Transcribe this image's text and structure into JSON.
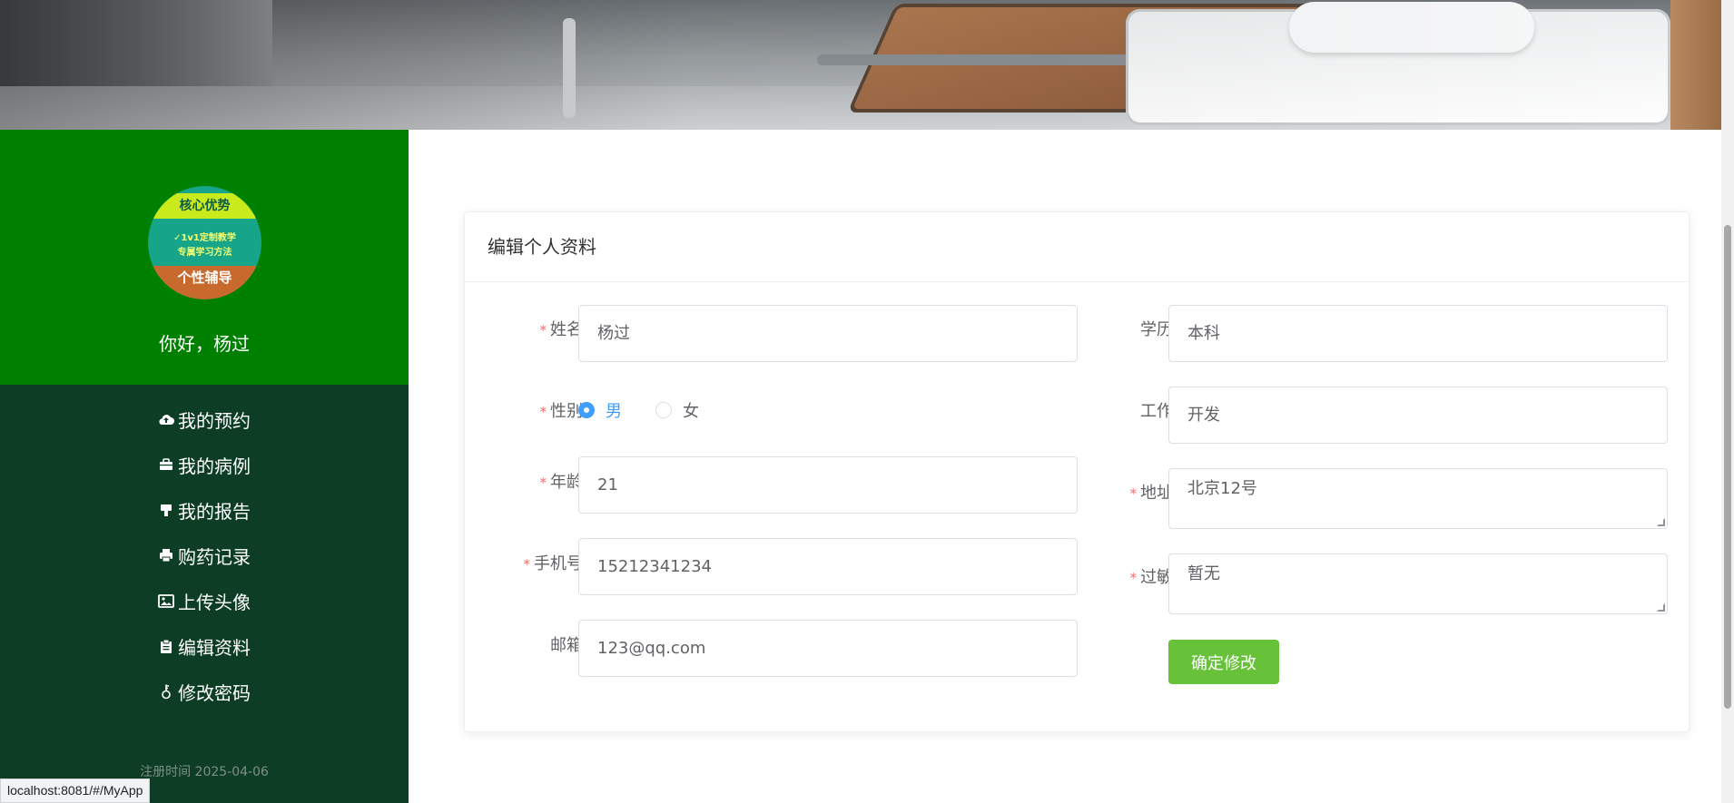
{
  "sidebar": {
    "avatar": {
      "badge_title": "核心优势",
      "line1": "✓1v1定制教学",
      "line2": "专属学习方法",
      "badge_bottom": "个性辅导"
    },
    "greeting": "你好，杨过",
    "menu": [
      {
        "label": "我的预约",
        "icon": "cloud-upload-icon"
      },
      {
        "label": "我的病例",
        "icon": "briefcase-icon"
      },
      {
        "label": "我的报告",
        "icon": "desk-icon"
      },
      {
        "label": "购药记录",
        "icon": "printer-icon"
      },
      {
        "label": "上传头像",
        "icon": "picture-icon"
      },
      {
        "label": "编辑资料",
        "icon": "clipboard-icon"
      },
      {
        "label": "修改密码",
        "icon": "key-icon"
      }
    ],
    "register_time": "注册时间 2025-04-06"
  },
  "profile_form": {
    "title": "编辑个人资料",
    "name": {
      "label": "姓名",
      "value": "杨过",
      "required": true
    },
    "gender": {
      "label": "性别",
      "options": [
        "男",
        "女"
      ],
      "selected": "男",
      "required": true
    },
    "age": {
      "label": "年龄",
      "value": "21",
      "required": true
    },
    "phone": {
      "label": "手机号",
      "value": "15212341234",
      "required": true
    },
    "email": {
      "label": "邮箱",
      "value": "123@qq.com",
      "required": false
    },
    "education": {
      "label": "学历",
      "value": "本科",
      "required": false
    },
    "job": {
      "label": "工作",
      "value": "开发",
      "required": false
    },
    "address": {
      "label": "地址",
      "value": "北京12号",
      "required": true
    },
    "allergy": {
      "label": "过敏",
      "value": "暂无",
      "required": true
    },
    "submit_label": "确定修改"
  },
  "status_bar": {
    "url": "localhost:8081/#/MyApp"
  },
  "colors": {
    "sidebar_top": "#008000",
    "sidebar_menu": "#0e3d26",
    "primary": "#409eff",
    "success_button": "#67c23a",
    "required_star": "#f56c6c"
  }
}
